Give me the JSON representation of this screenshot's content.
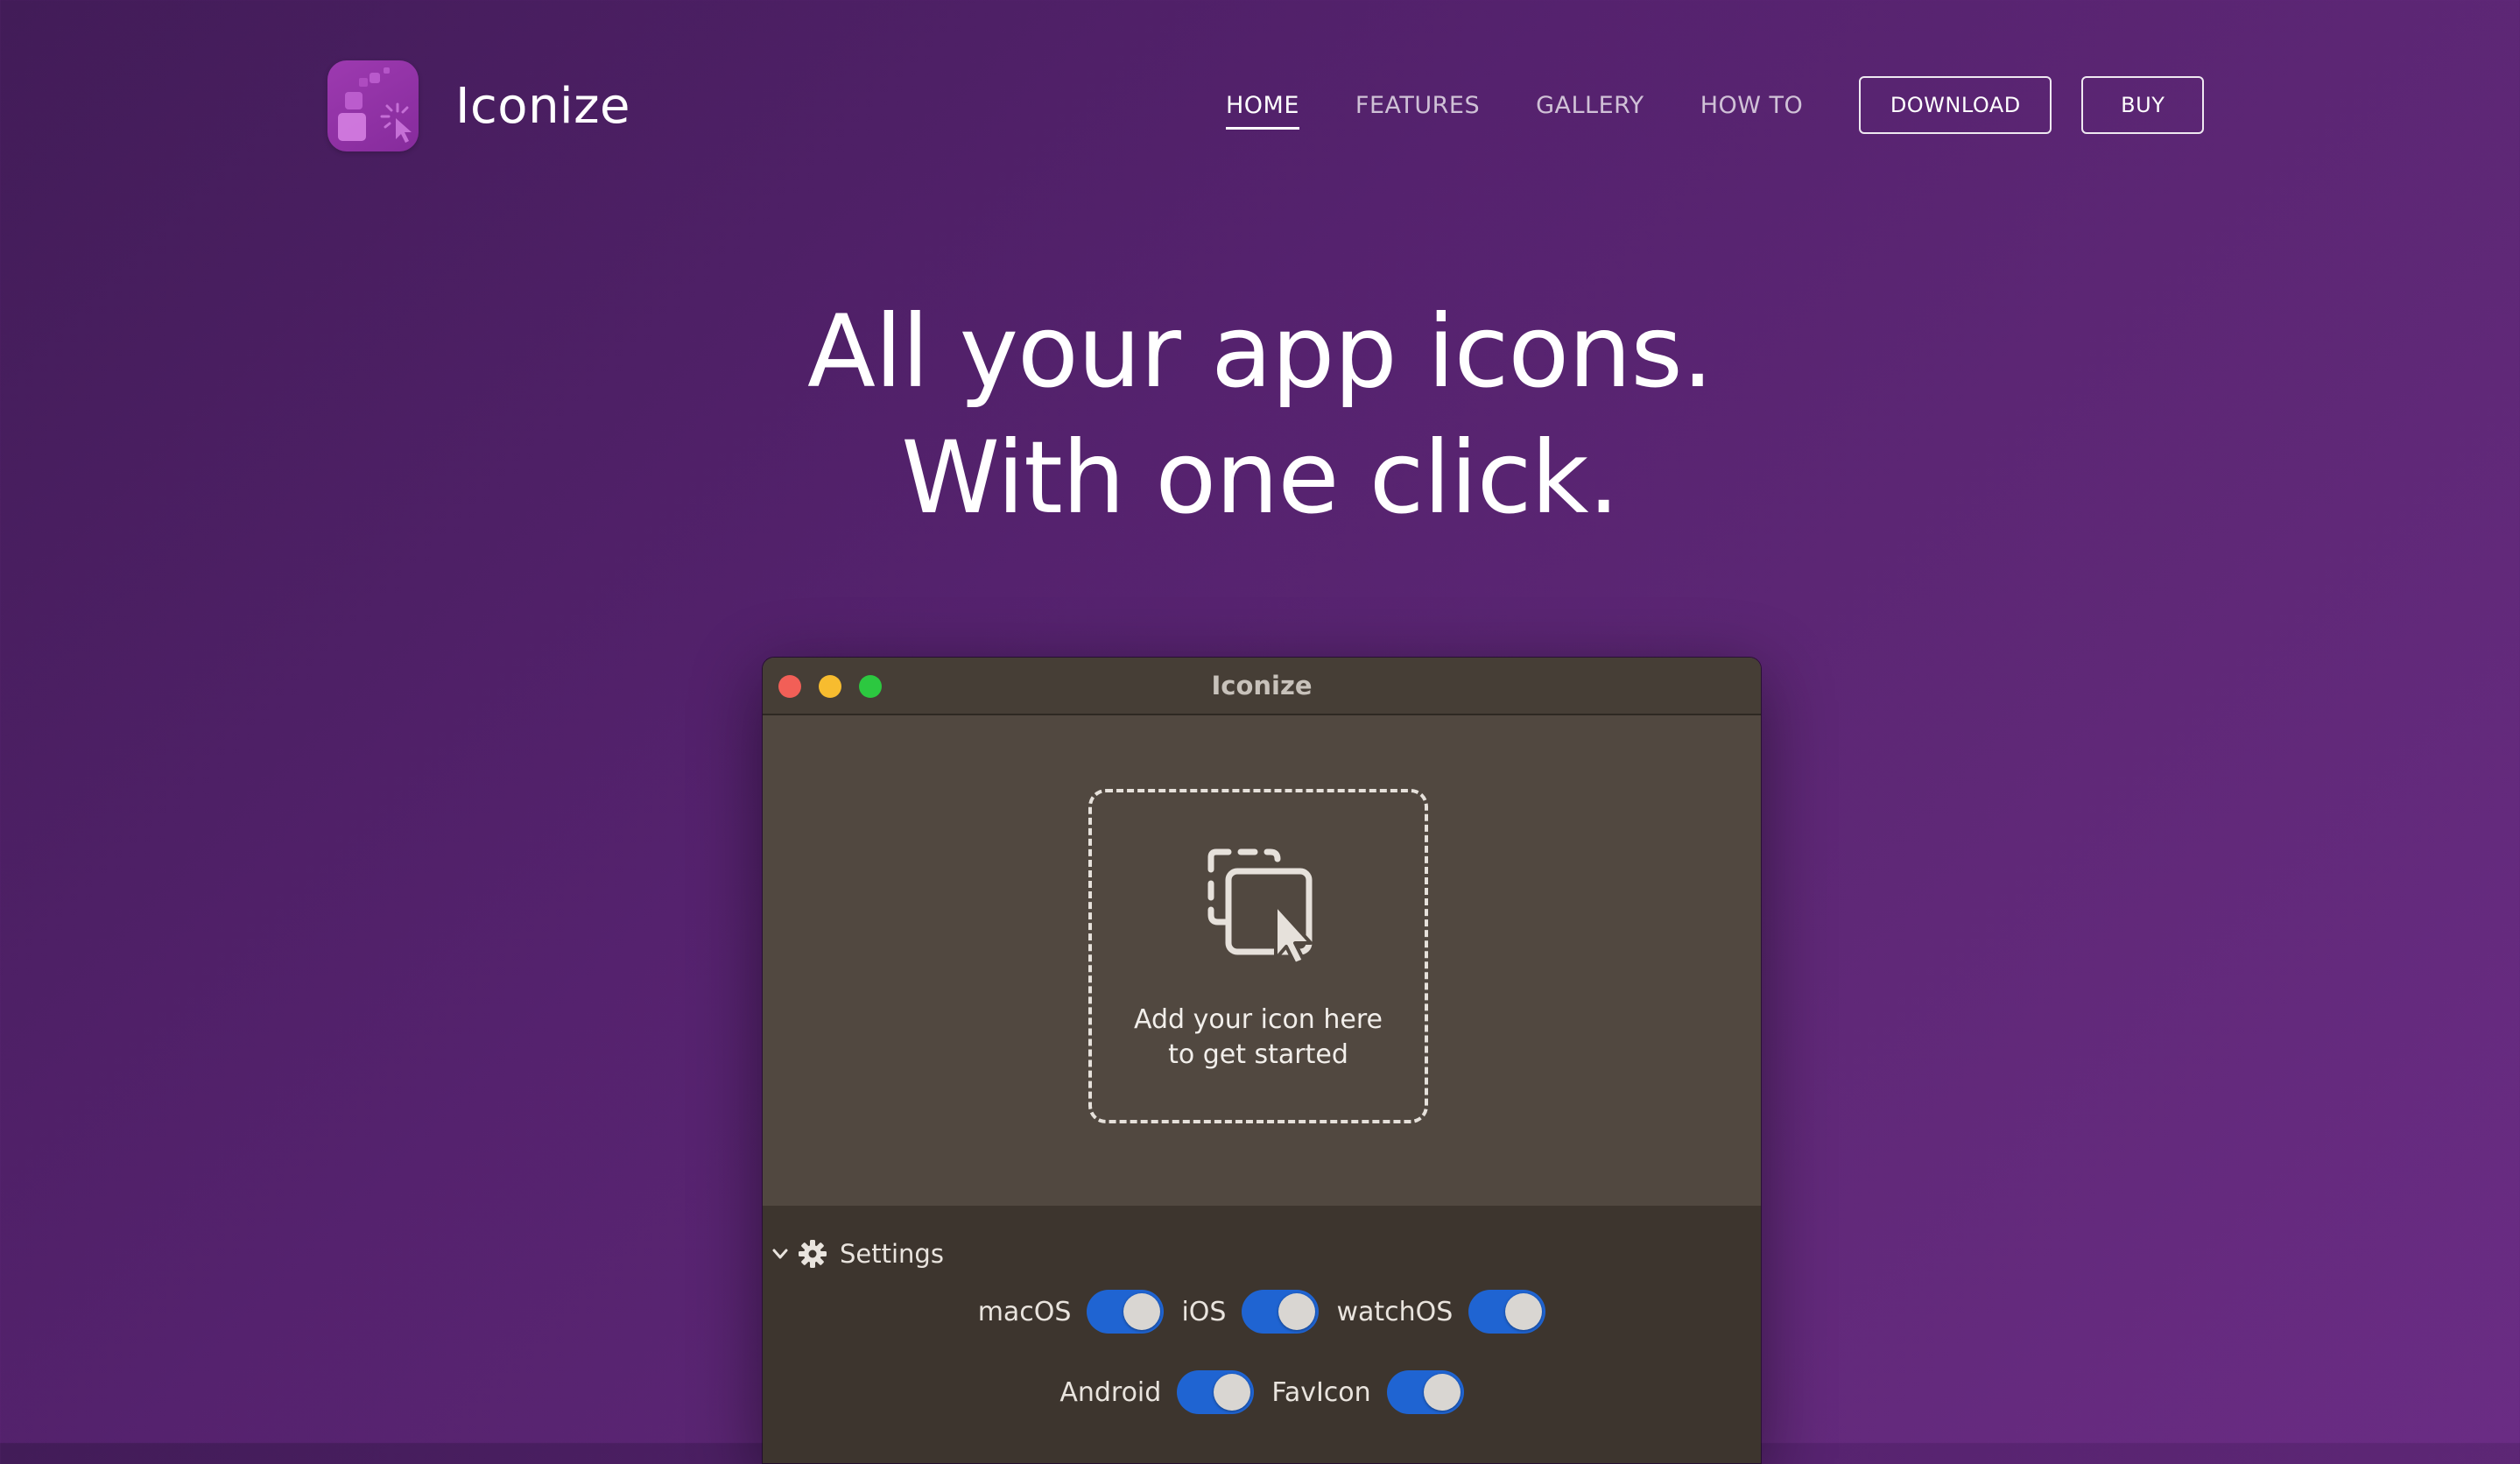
{
  "brand": {
    "name": "Iconize"
  },
  "nav": {
    "links": [
      "HOME",
      "FEATURES",
      "GALLERY",
      "HOW TO"
    ],
    "active": "HOME",
    "download_label": "DOWNLOAD",
    "buy_label": "BUY"
  },
  "hero": {
    "line1": "All your app icons.",
    "line2": "With one click."
  },
  "app_window": {
    "title": "Iconize",
    "dropzone_text_line1": "Add your icon here",
    "dropzone_text_line2": "to get started",
    "settings_label": "Settings",
    "options": [
      {
        "label": "macOS",
        "enabled": true
      },
      {
        "label": "iOS",
        "enabled": true
      },
      {
        "label": "watchOS",
        "enabled": true
      },
      {
        "label": "Android",
        "enabled": true
      },
      {
        "label": "FavIcon",
        "enabled": true
      }
    ]
  },
  "colors": {
    "background_start": "#421c58",
    "background_end": "#6a2c84",
    "logo": "#9d3ab0",
    "toggle_on": "#1f64d2",
    "window_body": "#514840",
    "settings_panel": "#3d352e"
  },
  "icons": {
    "logo": "iconize-logo-icon",
    "dropzone": "drop-cursor-icon",
    "settings": "gear-icon",
    "disclosure": "chevron-down-icon"
  }
}
